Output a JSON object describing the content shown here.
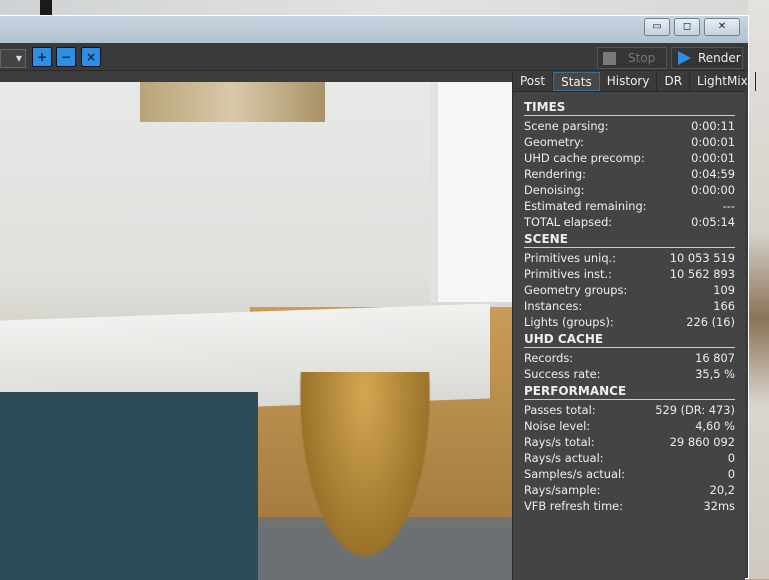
{
  "window": {
    "minimize": "▭",
    "maximize": "◻",
    "close": "✕"
  },
  "toolbar": {
    "zoom_in": "+",
    "zoom_out": "−",
    "zoom_fit": "×",
    "stop": "Stop",
    "render": "Render"
  },
  "tabs": [
    "Post",
    "Stats",
    "History",
    "DR",
    "LightMix"
  ],
  "active_tab": "Stats",
  "sections": [
    {
      "title": "TIMES",
      "rows": [
        [
          "Scene parsing:",
          "0:00:11"
        ],
        [
          "Geometry:",
          "0:00:01"
        ],
        [
          "UHD cache precomp:",
          "0:00:01"
        ],
        [
          "Rendering:",
          "0:04:59"
        ],
        [
          "Denoising:",
          "0:00:00"
        ],
        [
          "Estimated remaining:",
          "---"
        ],
        [
          "TOTAL elapsed:",
          "0:05:14"
        ]
      ]
    },
    {
      "title": "SCENE",
      "rows": [
        [
          "Primitives uniq.:",
          "10 053 519"
        ],
        [
          "Primitives inst.:",
          "10 562 893"
        ],
        [
          "Geometry groups:",
          "109"
        ],
        [
          "Instances:",
          "166"
        ],
        [
          "Lights (groups):",
          "226 (16)"
        ]
      ]
    },
    {
      "title": "UHD CACHE",
      "rows": [
        [
          "Records:",
          "16 807"
        ],
        [
          "Success rate:",
          "35,5 %"
        ]
      ]
    },
    {
      "title": "PERFORMANCE",
      "rows": [
        [
          "Passes total:",
          "529 (DR: 473)"
        ],
        [
          "Noise level:",
          "4,60 %"
        ],
        [
          "Rays/s total:",
          "29 860 092"
        ],
        [
          "Rays/s actual:",
          "0"
        ],
        [
          "Samples/s actual:",
          "0"
        ],
        [
          "Rays/sample:",
          "20,2"
        ],
        [
          "VFB refresh time:",
          "32ms"
        ]
      ]
    }
  ]
}
